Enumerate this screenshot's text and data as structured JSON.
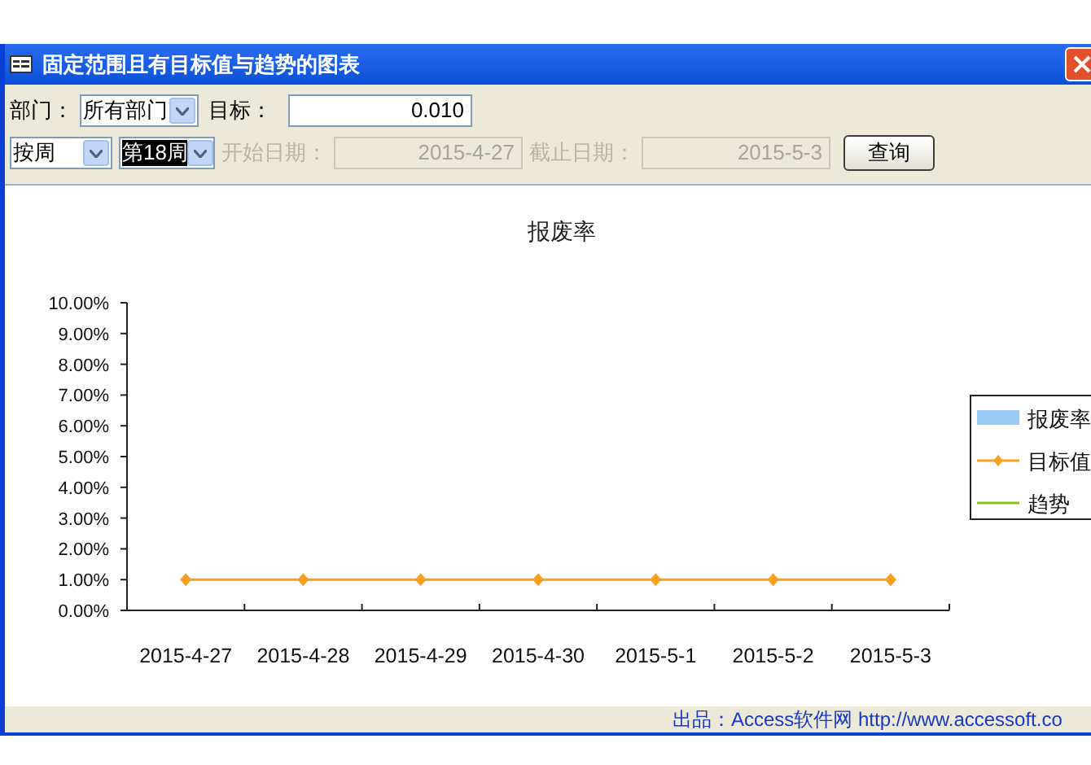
{
  "window": {
    "title": "固定范围且有目标值与趋势的图表"
  },
  "filters": [
    {
      "kind": "select",
      "label": "部门：",
      "value": "所有部门",
      "selected": false
    },
    {
      "kind": "input",
      "label": "目标：",
      "value": "0.010",
      "disabled": false
    }
  ],
  "filters_row2": [
    {
      "kind": "select",
      "value": "按周",
      "selected": false
    },
    {
      "kind": "select",
      "value": "第18周",
      "selected": true
    },
    {
      "kind": "input",
      "label": "开始日期：",
      "value": "2015-4-27",
      "disabled": true
    },
    {
      "kind": "input",
      "label": "截止日期：",
      "value": "2015-5-3",
      "disabled": true
    },
    {
      "kind": "button",
      "label": "查询",
      "disabled": false
    }
  ],
  "chart": {
    "chart_data": {
      "type": "bar",
      "title": "报废率",
      "categories": [
        "2015-4-27",
        "2015-4-28",
        "2015-4-29",
        "2015-4-30",
        "2015-5-1",
        "2015-5-2",
        "2015-5-3"
      ],
      "series": [
        {
          "name": "报废率",
          "type": "bar",
          "color": "#99c9f5",
          "values": [
            null,
            null,
            null,
            null,
            null,
            null,
            null
          ]
        },
        {
          "name": "目标值",
          "type": "line",
          "color": "#f5a020",
          "marker": true,
          "values": [
            0.01,
            0.01,
            0.01,
            0.01,
            0.01,
            0.01,
            0.01
          ]
        },
        {
          "name": "趋势",
          "type": "line",
          "color": "#88c020",
          "values": [
            null,
            null,
            null,
            null,
            null,
            null,
            null
          ]
        }
      ],
      "ylim": [
        0,
        0.1
      ],
      "yticks": [
        {
          "value": 0,
          "label": "0.00%"
        },
        {
          "value": 0.01,
          "label": "1.00%"
        },
        {
          "value": 0.02,
          "label": "2.00%"
        },
        {
          "value": 0.03,
          "label": "3.00%"
        },
        {
          "value": 0.04,
          "label": "4.00%"
        },
        {
          "value": 0.05,
          "label": "5.00%"
        },
        {
          "value": 0.06,
          "label": "6.00%"
        },
        {
          "value": 0.07,
          "label": "7.00%"
        },
        {
          "value": 0.08,
          "label": "8.00%"
        },
        {
          "value": 0.09,
          "label": "9.00%"
        },
        {
          "value": 0.1,
          "label": "10.00%"
        }
      ]
    }
  },
  "status_bar": {
    "credit": "出品：Access软件网 http://www.accessoft.co"
  }
}
